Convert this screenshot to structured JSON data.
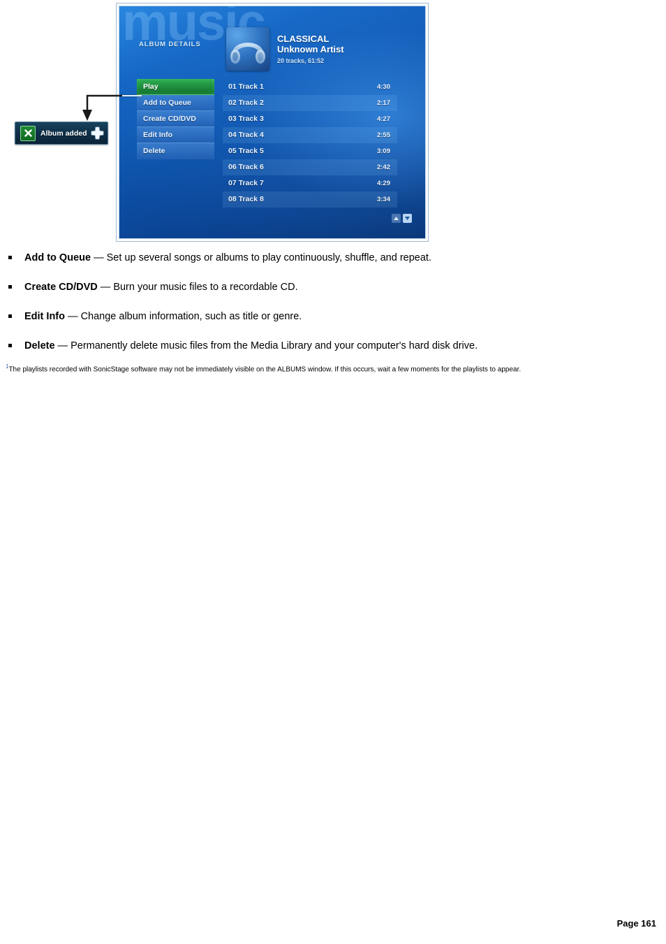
{
  "figure": {
    "app_watermark": "music",
    "section_label": "ALBUM DETAILS",
    "album": {
      "title": "CLASSICAL",
      "artist": "Unknown Artist",
      "stats": "20 tracks, 61:52",
      "art_icon": "headphones-icon"
    },
    "menu": {
      "items": [
        {
          "label": "Play",
          "selected": true
        },
        {
          "label": "Add to Queue",
          "selected": false
        },
        {
          "label": "Create CD/DVD",
          "selected": false
        },
        {
          "label": "Edit Info",
          "selected": false
        },
        {
          "label": "Delete",
          "selected": false
        }
      ]
    },
    "tracks": [
      {
        "name": "01 Track 1",
        "time": "4:30"
      },
      {
        "name": "02 Track 2",
        "time": "2:17"
      },
      {
        "name": "03 Track 3",
        "time": "4:27"
      },
      {
        "name": "04 Track 4",
        "time": "2:55"
      },
      {
        "name": "05 Track 5",
        "time": "3:09"
      },
      {
        "name": "06 Track 6",
        "time": "2:42"
      },
      {
        "name": "07 Track 7",
        "time": "4:29"
      },
      {
        "name": "08 Track 8",
        "time": "3:34"
      }
    ],
    "scroll": {
      "up_icon": "chevron-up-icon",
      "down_icon": "chevron-down-icon"
    },
    "callout": {
      "label": "Album added",
      "badge_icon": "x-mark-icon",
      "plus_icon": "plus-icon",
      "points_to": "Add to Queue"
    },
    "colors": {
      "selected_menu_green": "#1d8c3c",
      "panel_blue": "#0d51a8",
      "callout_navy": "#0f3048",
      "badge_green": "#126b24",
      "footnote_marker_blue": "#3b5ba8"
    }
  },
  "body": {
    "bullets": [
      {
        "term": "Add to Queue",
        "dash": " — ",
        "description": "Set up several songs or albums to play continuously, shuffle, and repeat."
      },
      {
        "term": "Create CD/DVD",
        "dash": " — ",
        "description": "Burn your music files to a recordable CD."
      },
      {
        "term": "Edit Info",
        "dash": " — ",
        "description": "Change album information, such as title or genre."
      },
      {
        "term": "Delete",
        "dash": " — ",
        "description": "Permanently delete music files from the Media Library and your computer's hard disk drive."
      }
    ],
    "footnote": {
      "marker": "1",
      "text": "The playlists recorded with SonicStage software may not be immediately visible on the ALBUMS window. If this occurs, wait a few moments for the playlists to appear."
    }
  },
  "footer": {
    "page_label": "Page 161"
  }
}
